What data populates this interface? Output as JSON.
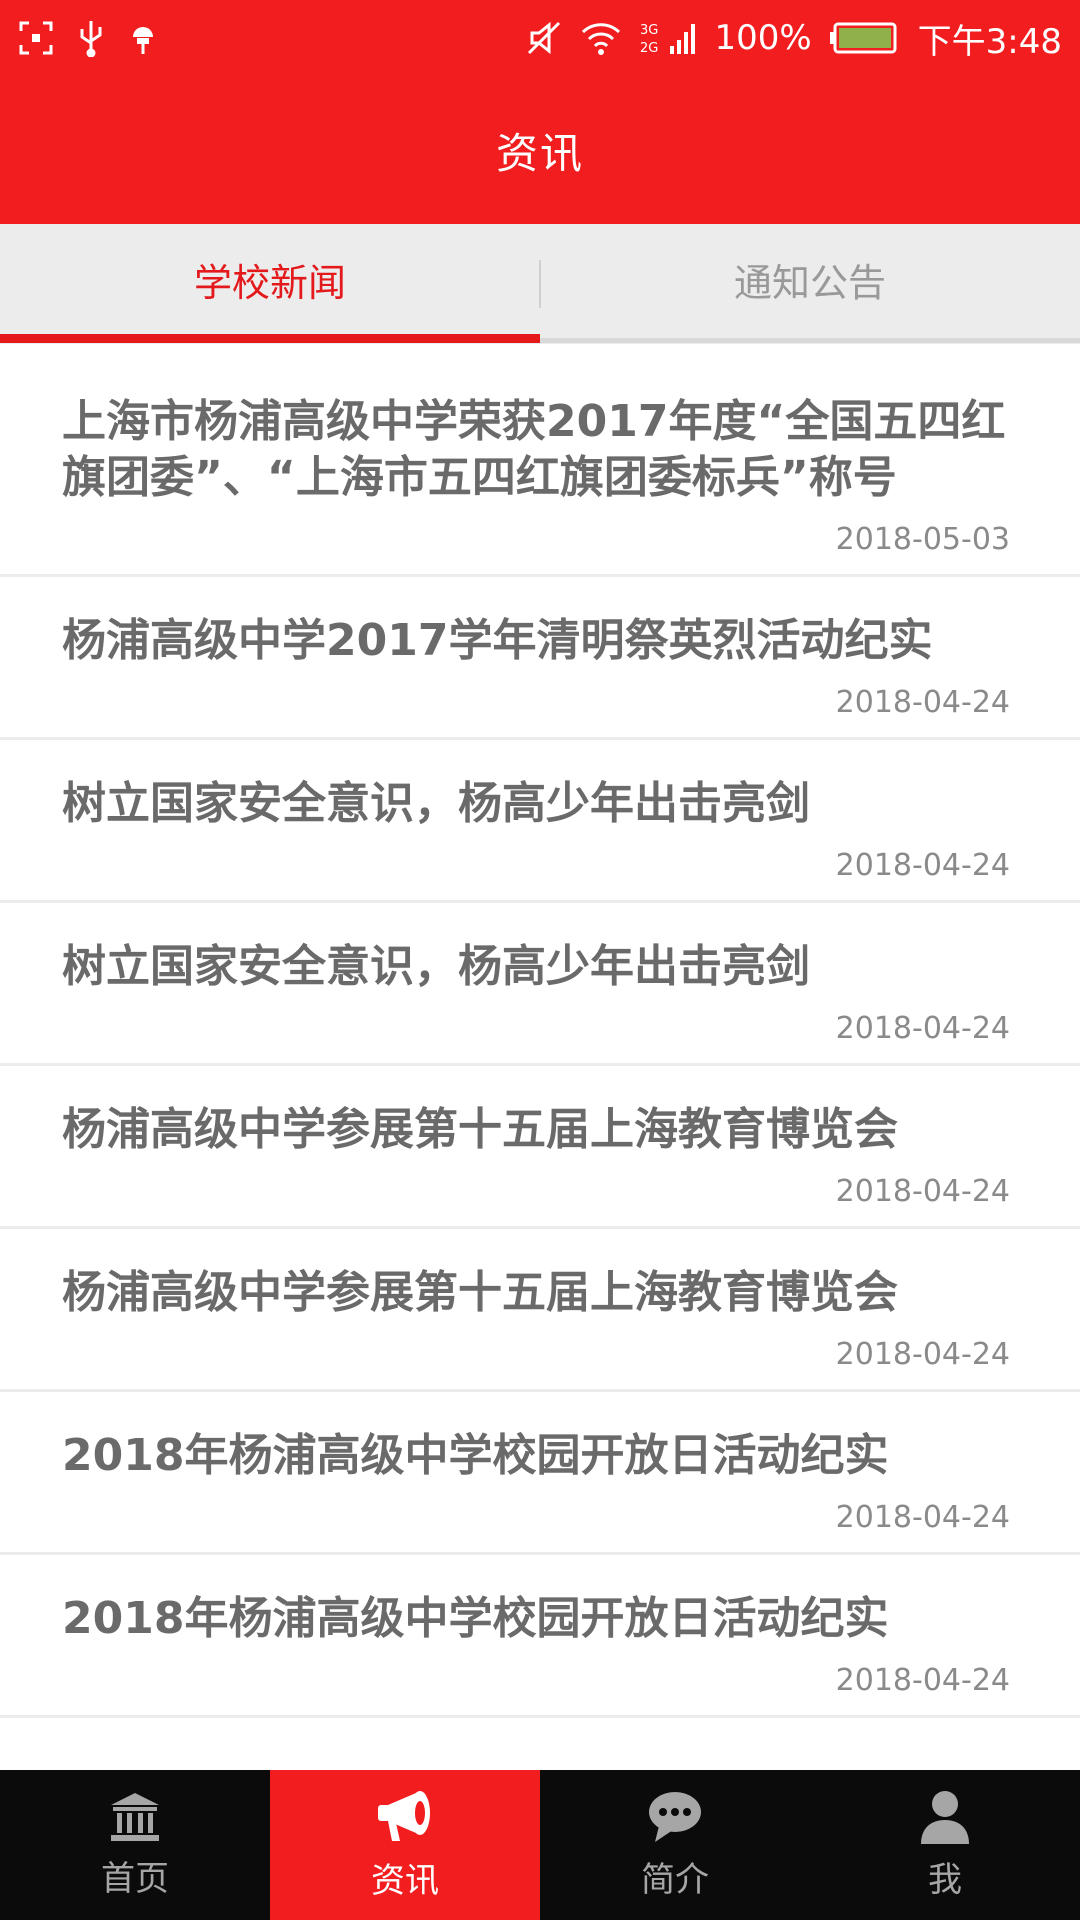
{
  "status_bar": {
    "battery": "100%",
    "time": "下午3:48",
    "network": "3G 2G"
  },
  "header": {
    "title": "资讯"
  },
  "tabs": [
    {
      "label": "学校新闻",
      "active": true
    },
    {
      "label": "通知公告",
      "active": false
    }
  ],
  "news": [
    {
      "title": "上海市杨浦高级中学荣获2017年度“全国五四红旗团委”、“上海市五四红旗团委标兵”称号",
      "date": "2018-05-03"
    },
    {
      "title": "杨浦高级中学2017学年清明祭英烈活动纪实",
      "date": "2018-04-24"
    },
    {
      "title": "树立国家安全意识，杨高少年出击亮剑",
      "date": "2018-04-24"
    },
    {
      "title": "树立国家安全意识，杨高少年出击亮剑",
      "date": "2018-04-24"
    },
    {
      "title": "杨浦高级中学参展第十五届上海教育博览会",
      "date": "2018-04-24"
    },
    {
      "title": "杨浦高级中学参展第十五届上海教育博览会",
      "date": "2018-04-24"
    },
    {
      "title": "2018年杨浦高级中学校园开放日活动纪实",
      "date": "2018-04-24"
    },
    {
      "title": "2018年杨浦高级中学校园开放日活动纪实",
      "date": "2018-04-24"
    }
  ],
  "bottom_nav": [
    {
      "label": "首页",
      "icon": "bank-icon",
      "active": false
    },
    {
      "label": "资讯",
      "icon": "megaphone-icon",
      "active": true
    },
    {
      "label": "简介",
      "icon": "chat-bubble-icon",
      "active": false
    },
    {
      "label": "我",
      "icon": "person-icon",
      "active": false
    }
  ],
  "colors": {
    "accent": "#f21d1f",
    "tab_active": "#e3191c",
    "nav_bg": "#0b0b0b"
  }
}
